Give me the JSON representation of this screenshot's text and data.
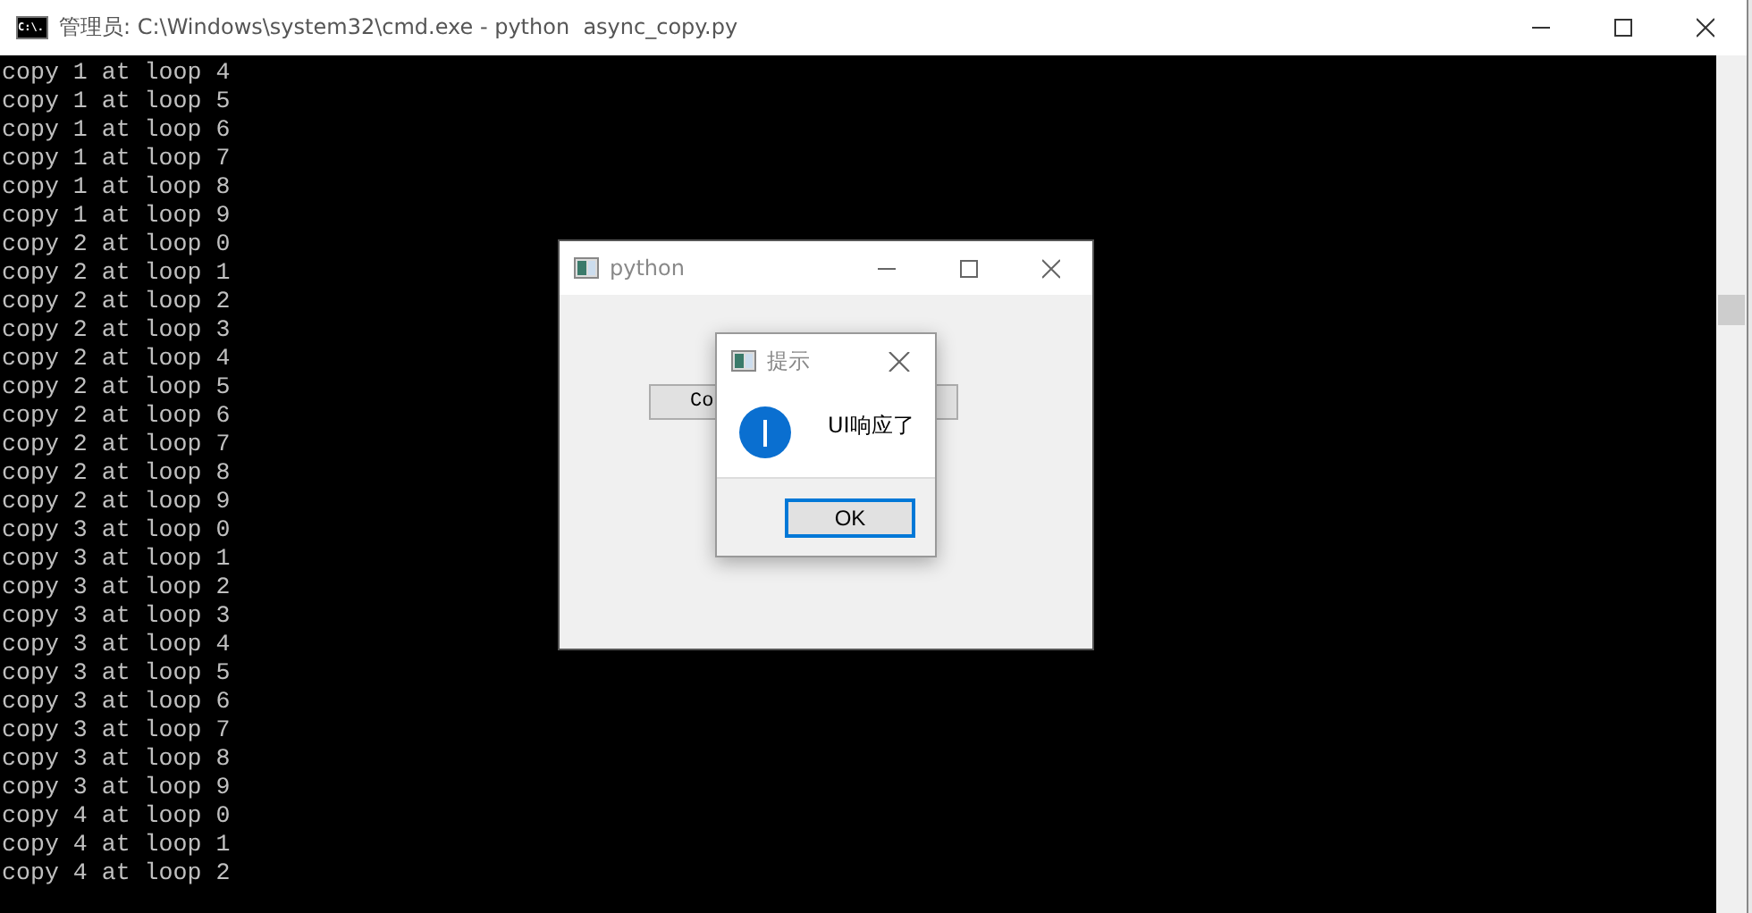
{
  "console_window": {
    "title": "管理员: C:\\Windows\\system32\\cmd.exe - python  async_copy.py",
    "icon_text": "C:\\.",
    "lines": [
      "copy 1 at loop 4",
      "copy 1 at loop 5",
      "copy 1 at loop 6",
      "copy 1 at loop 7",
      "copy 1 at loop 8",
      "copy 1 at loop 9",
      "copy 2 at loop 0",
      "copy 2 at loop 1",
      "copy 2 at loop 2",
      "copy 2 at loop 3",
      "copy 2 at loop 4",
      "copy 2 at loop 5",
      "copy 2 at loop 6",
      "copy 2 at loop 7",
      "copy 2 at loop 8",
      "copy 2 at loop 9",
      "copy 3 at loop 0",
      "copy 3 at loop 1",
      "copy 3 at loop 2",
      "copy 3 at loop 3",
      "copy 3 at loop 4",
      "copy 3 at loop 5",
      "copy 3 at loop 6",
      "copy 3 at loop 7",
      "copy 3 at loop 8",
      "copy 3 at loop 9",
      "copy 4 at loop 0",
      "copy 4 at loop 1",
      "copy 4 at loop 2"
    ]
  },
  "app_window": {
    "title": "python",
    "button": "Co"
  },
  "message_box": {
    "title": "提示",
    "message": "UI响应了",
    "button": "OK"
  }
}
